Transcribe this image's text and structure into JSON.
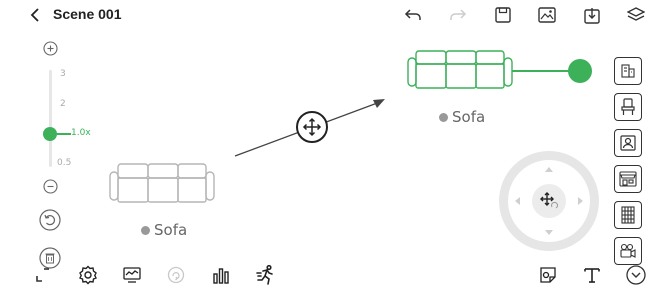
{
  "header": {
    "title": "Scene 001",
    "back_icon": "chevron-left-icon",
    "actions": [
      "undo-icon",
      "redo-icon",
      "save-icon",
      "image-icon",
      "export-icon",
      "layers-icon"
    ]
  },
  "zoom": {
    "ticks": [
      "3",
      "2",
      "0.5"
    ],
    "current_label": "1.0x",
    "plus_icon": "zoom-in-icon",
    "minus_icon": "zoom-out-icon"
  },
  "objects": {
    "sofa_left_label": "Sofa",
    "sofa_right_label": "Sofa"
  },
  "right_toolbar": [
    "building-icon",
    "chair-icon",
    "person-icon",
    "storefront-icon",
    "shelf-icon",
    "camera-icon"
  ],
  "bottom_bar": [
    "fullscreen-icon",
    "settings-icon",
    "monitor-icon",
    "cycle-icon",
    "bar-chart-icon",
    "running-icon"
  ],
  "bottom_right": [
    "sticker-icon",
    "text-icon",
    "chevron-down-icon"
  ],
  "colors": {
    "accent": "#3cb15a",
    "sofa_outline": "#b5b5b5",
    "label_dot": "#999999"
  }
}
